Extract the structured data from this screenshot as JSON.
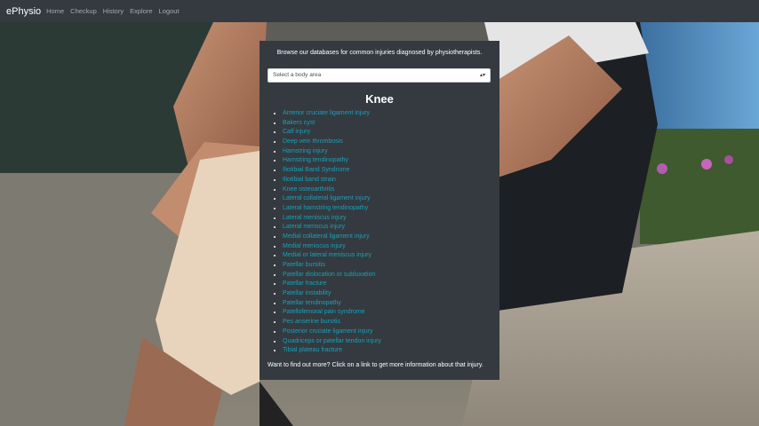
{
  "navbar": {
    "brand": "ePhysio",
    "links": [
      "Home",
      "Checkup",
      "History",
      "Explore",
      "Logout"
    ]
  },
  "panel": {
    "intro": "Browse our databases for common injuries diagnosed by physiotherapists.",
    "select_value": "Select a body area",
    "area_title": "Knee",
    "injuries": [
      "Anterior cruciate ligament injury",
      "Bakers cyst",
      "Calf injury",
      "Deep vein thrombosis",
      "Hamstring injury",
      "Hamstring tendinopathy",
      "Iliotibial Band Syndrome",
      "Iliotibial band strain",
      "Knee osteoarthritis",
      "Lateral collateral ligament injury",
      "Lateral hamstring tendinopathy",
      "Lateral meniscus injury",
      "Lateral menscus injury",
      "Medial collateral ligament injury",
      "Medial meniscus injury",
      "Medial or lateral meniscus injury",
      "Patellar bursitis",
      "Patellar dislocation or subluxation",
      "Patellar fracture",
      "Patellar instability",
      "Patellar tendinopathy",
      "Patellofemoral pain syndrome",
      "Pes anserine bursitis",
      "Posterior cruciate ligament injury",
      "Quadriceps or patellar tendon injury",
      "Tibial plateau fracture"
    ],
    "footer": "Want to find out more? Click on a link to get more information about that injury."
  },
  "colors": {
    "navbar_bg": "#343a40",
    "panel_bg": "#343a40",
    "link": "#17a2b8",
    "text": "#ffffff"
  },
  "icons": {
    "select_arrow": "chevron-updown-icon",
    "list_bullet": "disc-bullet"
  }
}
